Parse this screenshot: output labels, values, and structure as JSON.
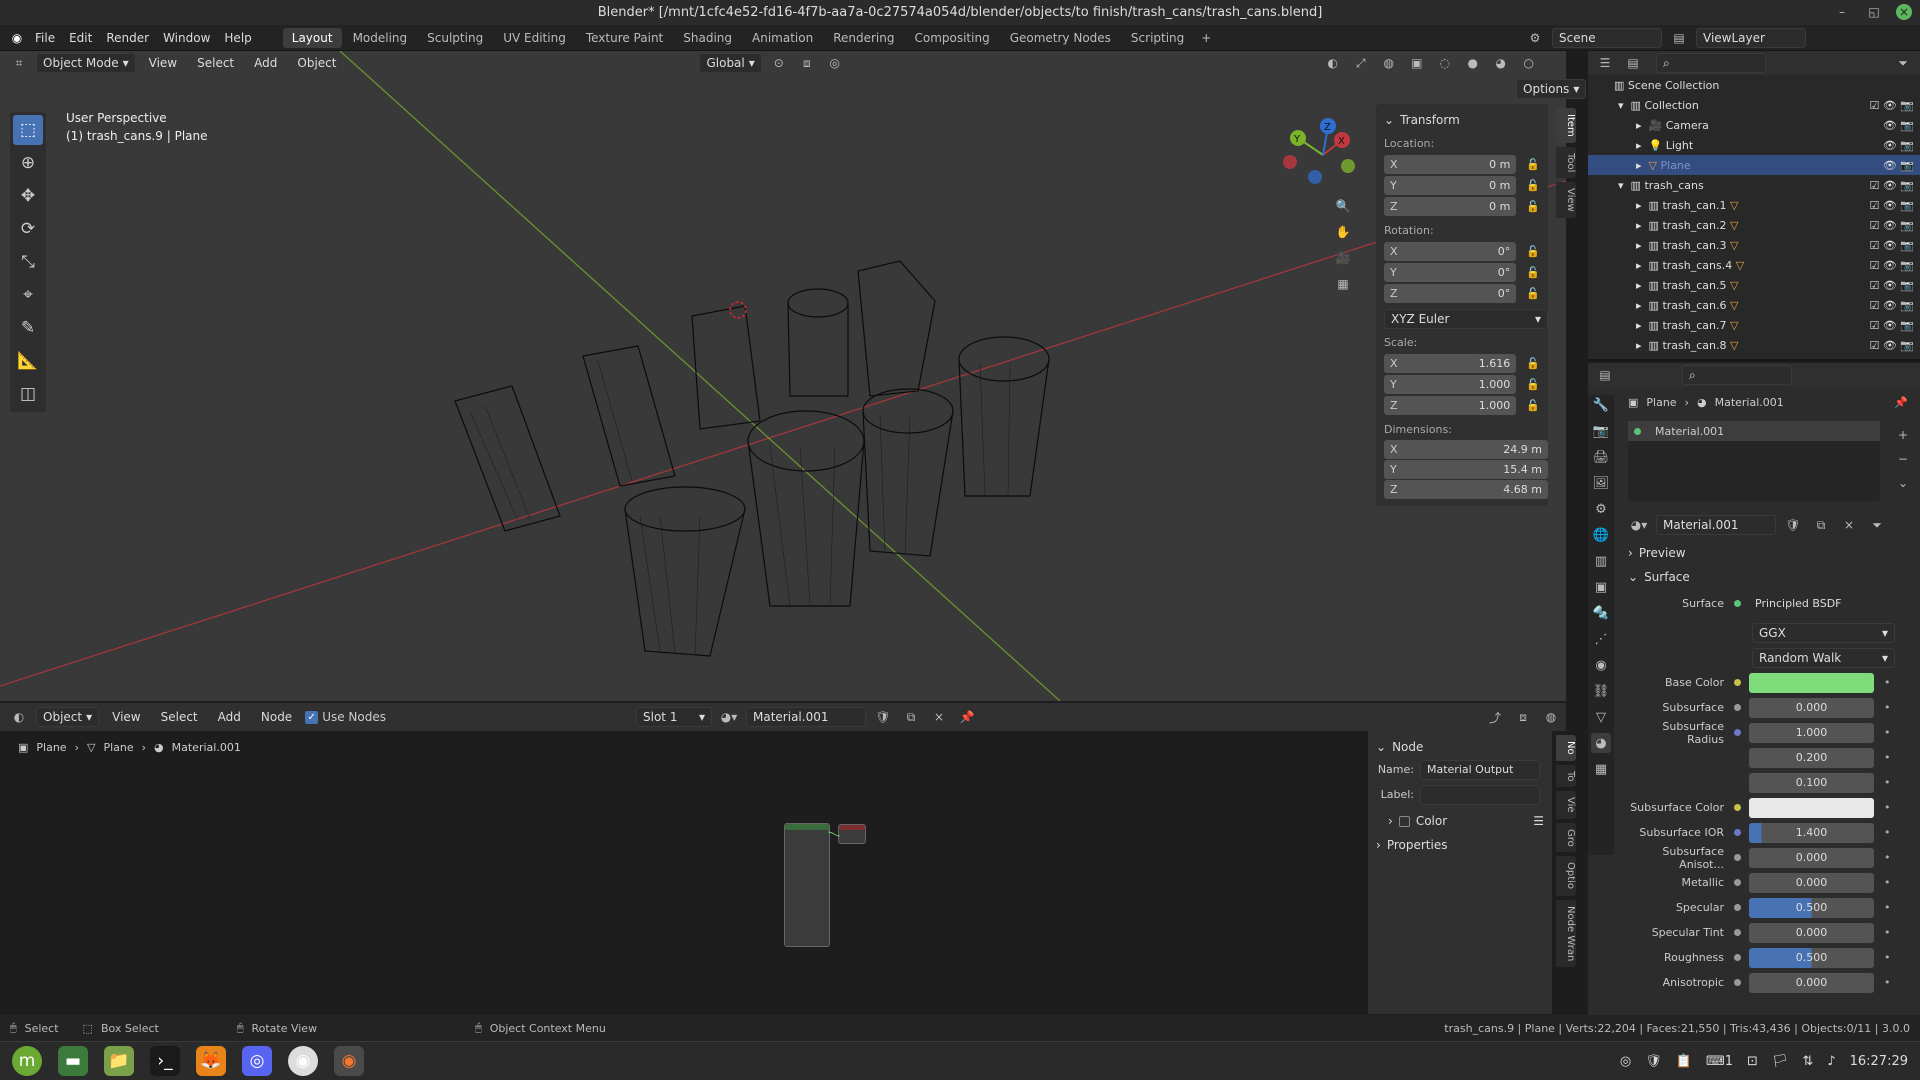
{
  "window": {
    "title": "Blender* [/mnt/1cfc4e52-fd16-4f7b-aa7a-0c27574a054d/blender/objects/to finish/trash_cans/trash_cans.blend]"
  },
  "menubar": {
    "items": [
      "File",
      "Edit",
      "Render",
      "Window",
      "Help"
    ]
  },
  "workspaces": [
    "Layout",
    "Modeling",
    "Sculpting",
    "UV Editing",
    "Texture Paint",
    "Shading",
    "Animation",
    "Rendering",
    "Compositing",
    "Geometry Nodes",
    "Scripting"
  ],
  "scene": {
    "label": "Scene",
    "viewlayer": "ViewLayer"
  },
  "viewport": {
    "mode": "Object Mode",
    "menus": [
      "View",
      "Select",
      "Add",
      "Object"
    ],
    "orientation": "Global",
    "options": "Options",
    "overlay_title": "User Perspective",
    "overlay_sub": "(1) trash_cans.9 | Plane",
    "gizmo_axes": [
      "X",
      "Y",
      "Z"
    ]
  },
  "npanel": {
    "title": "Transform",
    "location_label": "Location:",
    "rotation_label": "Rotation:",
    "scale_label": "Scale:",
    "dimensions_label": "Dimensions:",
    "axes": [
      "X",
      "Y",
      "Z"
    ],
    "location": [
      "0 m",
      "0 m",
      "0 m"
    ],
    "rotation": [
      "0°",
      "0°",
      "0°"
    ],
    "rotation_mode": "XYZ Euler",
    "scale": [
      "1.616",
      "1.000",
      "1.000"
    ],
    "dimensions": [
      "24.9 m",
      "15.4 m",
      "4.68 m"
    ],
    "tabs": [
      "Item",
      "Tool",
      "View"
    ]
  },
  "outliner": {
    "root": "Scene Collection",
    "collection": "Collection",
    "collection_items": [
      "Camera",
      "Light",
      "Plane"
    ],
    "trash_collection": "trash_cans",
    "trash_items": [
      "trash_can.1",
      "trash_can.2",
      "trash_can.3",
      "trash_cans.4",
      "trash_can.5",
      "trash_can.6",
      "trash_can.7",
      "trash_can.8"
    ]
  },
  "properties": {
    "breadcrumb_obj": "Plane",
    "breadcrumb_mat": "Material.001",
    "slot_material": "Material.001",
    "material_name": "Material.001",
    "preview": "Preview",
    "surface_section": "Surface",
    "surface_label": "Surface",
    "surface_value": "Principled BSDF",
    "distribution": "GGX",
    "subsurface_method": "Random Walk",
    "rows": [
      {
        "label": "Base Color",
        "value": "",
        "kind": "color",
        "color": "#7fdc7a"
      },
      {
        "label": "Subsurface",
        "value": "0.000",
        "kind": "num"
      },
      {
        "label": "Subsurface Radius",
        "value": "1.000",
        "kind": "num"
      },
      {
        "label": "",
        "value": "0.200",
        "kind": "num"
      },
      {
        "label": "",
        "value": "0.100",
        "kind": "num"
      },
      {
        "label": "Subsurface Color",
        "value": "",
        "kind": "color",
        "color": "#e8e8e8"
      },
      {
        "label": "Subsurface IOR",
        "value": "1.400",
        "kind": "num"
      },
      {
        "label": "Subsurface Anisot...",
        "value": "0.000",
        "kind": "num"
      },
      {
        "label": "Metallic",
        "value": "0.000",
        "kind": "num"
      },
      {
        "label": "Specular",
        "value": "0.500",
        "kind": "num"
      },
      {
        "label": "Specular Tint",
        "value": "0.000",
        "kind": "num"
      },
      {
        "label": "Roughness",
        "value": "0.500",
        "kind": "num"
      },
      {
        "label": "Anisotropic",
        "value": "0.000",
        "kind": "num"
      }
    ]
  },
  "node_editor": {
    "type": "Object",
    "menus": [
      "View",
      "Select",
      "Add",
      "Node"
    ],
    "use_nodes": "Use Nodes",
    "slot": "Slot 1",
    "material": "Material.001",
    "breadcrumb": [
      "Plane",
      "Plane",
      "Material.001"
    ],
    "panel_title": "Node",
    "name_label": "Name:",
    "name_value": "Material Output",
    "label_label": "Label:",
    "color": "Color",
    "properties": "Properties",
    "tabs": [
      "No",
      "To",
      "Vie",
      "Gro",
      "Optio",
      "Node Wran"
    ]
  },
  "statusbar": {
    "select": "Select",
    "box_select": "Box Select",
    "rotate": "Rotate View",
    "context": "Object Context Menu",
    "stats": "trash_cans.9 | Plane | Verts:22,204 | Faces:21,550 | Tris:43,436 | Objects:0/11 | 3.0.0"
  },
  "taskbar": {
    "clock": "16:27:29",
    "keyboard": "1"
  },
  "colors": {
    "accent": "#4772b3",
    "x_axis": "#c2383e",
    "y_axis": "#7ab22c",
    "z_axis": "#2f6fd4"
  }
}
